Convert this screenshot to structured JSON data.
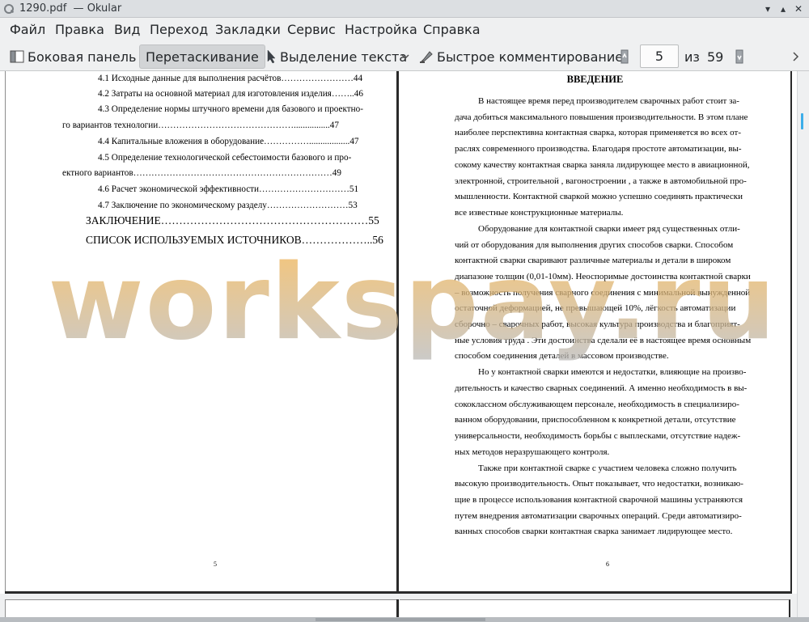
{
  "window": {
    "title": "1290.pdf  — Okular",
    "minimize": "▾",
    "maximize": "▴",
    "close": "✕"
  },
  "menu": [
    "Файл",
    "Правка",
    "Вид",
    "Переход",
    "Закладки",
    "Сервис",
    "Настройка",
    "Справка"
  ],
  "toolbar": {
    "sidebar": "Боковая панель",
    "browse": "Перетаскивание",
    "text_select": "Выделение текста",
    "review": "Быстрое комментирование",
    "page_current": "5",
    "page_of": "из",
    "page_total": "59"
  },
  "left_page": {
    "toc": [
      "4.1 Исходные данные для выполнения расчётов……………………44",
      "4.2 Затраты на основной материал для изготовления изделия……..46",
      "4.3 Определение нормы штучного времени для базового и проектно-",
      "го вариантов технологии………………………………………................47",
      "4.4 Капитальные вложения в оборудование……………..................47",
      "4.5 Определение технологической себестоимости базового и про-",
      "ектного вариантов…………………………………………………………49",
      "4.6 Расчет экономической эффективности…………………………51",
      "4.7 Заключение по экономическому разделу………………………53",
      "ЗАКЛЮЧЕНИЕ…………………………………………………55",
      "СПИСОК ИСПОЛЬЗУЕМЫХ ИСТОЧНИКОВ………………..56"
    ],
    "page_number": "5"
  },
  "right_page": {
    "heading": "ВВЕДЕНИЕ",
    "lines": [
      "В настоящее время  перед производителем сварочных работ стоит за-",
      "дача добиться максимального повышения производительности. В этом  плане",
      "наиболее перспективна контактная сварка, которая применяется во всех от-",
      "раслях современного производства.  Благодаря простоте автоматизации, вы-",
      "сокому качеству контактная сварка заняла лидирующее место в авиационной,",
      "электронной, строительной , вагоностроении , а также в автомобильной про-",
      "мышленности. Контактной сваркой можно успешно соединять практически",
      "все известные конструкционные материалы.",
      "Оборудование для контактной сварки имеет ряд существенных отли-",
      "чий от оборудования для выполнения других способов сварки. Способом",
      "контактной сварки сваривают различные материалы и детали в широком",
      "диапазоне толщин (0,01-10мм). Неоспоримые достоинства контактной сварки",
      "– возможность получения сварного соединения с минимальной вынужденной",
      "остаточной деформацией, не превышающей 10%, лёгкость автоматизации",
      "сборочно – сварочных работ, высокая культура производства и благоприят-",
      "ные условия труда . Эти достоинства сделали её в настоящее время основным",
      "способом соединения деталей в массовом производстве.",
      "Но у контактной сварки имеются и недостатки, влияющие на произво-",
      "дительность и качество сварных соединений. А именно необходимость в вы-",
      "сококлассном обслуживающем персонале, необходимость в специализиро-",
      "ванном оборудовании, приспособленном к конкретной детали, отсутствие",
      "универсальности, необходимость борьбы с выплесками, отсутствие надеж-",
      "ных методов неразрушающего контроля.",
      "Также  при контактной сварке с участием человека сложно получить",
      "высокую производительность. Опыт показывает, что недостатки, возникаю-",
      "щие в процессе использования контактной сварочной машины  устраняются",
      "путем внедрения автоматизации  сварочных операций. Среди автоматизиро-",
      "ванных способов сварки  контактная сварка занимает лидирующее место."
    ],
    "page_number": "6"
  },
  "watermark": "workspay.ru",
  "colors": {
    "accent": "#3daee9",
    "watermark_orange": "#f0a020",
    "watermark_gray": "#b4b4b4"
  }
}
